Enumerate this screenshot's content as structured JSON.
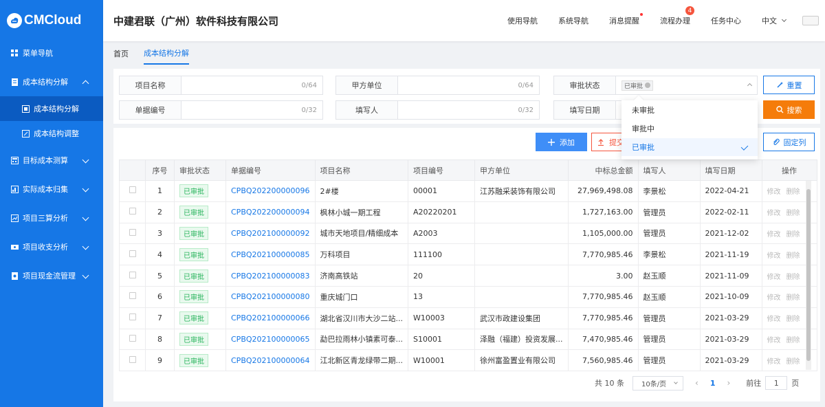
{
  "app": {
    "logo_text": "CMCloud",
    "company": "中建君联（广州）软件科技有限公司"
  },
  "sidebar": {
    "items": [
      {
        "label": "菜单导航",
        "icon": "grid-icon"
      },
      {
        "label": "成本结构分解",
        "icon": "document-icon",
        "expanded": true,
        "children": [
          {
            "label": "成本结构分解",
            "active": true
          },
          {
            "label": "成本结构调整",
            "active": false
          }
        ]
      },
      {
        "label": "目标成本测算",
        "icon": "calc-icon"
      },
      {
        "label": "实际成本归集",
        "icon": "chart-icon"
      },
      {
        "label": "项目三算分析",
        "icon": "analysis-icon"
      },
      {
        "label": "项目收支分析",
        "icon": "money-icon"
      },
      {
        "label": "项目现金流管理",
        "icon": "cashflow-icon"
      }
    ]
  },
  "header": {
    "nav": [
      {
        "label": "使用导航"
      },
      {
        "label": "系统导航"
      },
      {
        "label": "消息提醒",
        "dot": true
      },
      {
        "label": "流程办理",
        "badge": "4"
      },
      {
        "label": "任务中心"
      }
    ],
    "language": "中文"
  },
  "tabs": [
    {
      "label": "首页",
      "active": false
    },
    {
      "label": "成本结构分解",
      "active": true
    }
  ],
  "search": {
    "project_name": {
      "label": "项目名称",
      "counter": "0/64"
    },
    "party_a": {
      "label": "甲方单位",
      "counter": "0/64"
    },
    "approval_status": {
      "label": "审批状态",
      "selected_tag": "已审批"
    },
    "doc_no": {
      "label": "单据编号",
      "counter": "0/32"
    },
    "filler": {
      "label": "填写人",
      "counter": "0/32"
    },
    "fill_date": {
      "label": "填写日期"
    },
    "reset_label": "重置",
    "search_label": "搜索"
  },
  "dropdown": {
    "options": [
      {
        "label": "未审批",
        "selected": false
      },
      {
        "label": "审批中",
        "selected": false
      },
      {
        "label": "已审批",
        "selected": true
      }
    ]
  },
  "toolbar": {
    "add_label": "添加",
    "submit_label": "提交",
    "fix_columns_label": "固定列"
  },
  "table": {
    "columns": [
      "序号",
      "审批状态",
      "单据编号",
      "项目名称",
      "项目编号",
      "甲方单位",
      "中标总金额",
      "填写人",
      "填写日期",
      "操作"
    ],
    "edit_label": "修改",
    "delete_label": "删除",
    "rows": [
      {
        "no": "1",
        "status": "已审批",
        "code": "CPBQ202200000096",
        "name": "2#楼",
        "project_no": "00001",
        "party_a": "江苏融采装饰有限公司",
        "amount": "27,969,498.08",
        "filler": "李景松",
        "date": "2022-04-21"
      },
      {
        "no": "2",
        "status": "已审批",
        "code": "CPBQ202200000094",
        "name": "枫林小城一期工程",
        "project_no": "A20220201",
        "party_a": "",
        "amount": "1,727,163.00",
        "filler": "管理员",
        "date": "2022-02-11"
      },
      {
        "no": "3",
        "status": "已审批",
        "code": "CPBQ202100000092",
        "name": "城市天地项目/精细成本",
        "project_no": "A2003",
        "party_a": "",
        "amount": "1,105,000.00",
        "filler": "管理员",
        "date": "2021-12-02"
      },
      {
        "no": "4",
        "status": "已审批",
        "code": "CPBQ202100000085",
        "name": "万科项目",
        "project_no": "111100",
        "party_a": "",
        "amount": "7,770,985.46",
        "filler": "李景松",
        "date": "2021-11-19"
      },
      {
        "no": "5",
        "status": "已审批",
        "code": "CPBQ202100000083",
        "name": "济南高铁站",
        "project_no": "20",
        "party_a": "",
        "amount": "3.00",
        "filler": "赵玉顺",
        "date": "2021-11-09"
      },
      {
        "no": "6",
        "status": "已审批",
        "code": "CPBQ202100000080",
        "name": "重庆城门口",
        "project_no": "13",
        "party_a": "",
        "amount": "7,770,985.46",
        "filler": "赵玉顺",
        "date": "2021-10-09"
      },
      {
        "no": "7",
        "status": "已审批",
        "code": "CPBQ202100000066",
        "name": "湖北省汉川市大沙二站...",
        "project_no": "W10003",
        "party_a": "武汉市政建设集团",
        "amount": "7,770,985.46",
        "filler": "管理员",
        "date": "2021-03-29"
      },
      {
        "no": "8",
        "status": "已审批",
        "code": "CPBQ202100000065",
        "name": "勐巴拉雨林小镇素可泰...",
        "project_no": "S10001",
        "party_a": "泽融（福建）投资发展...",
        "amount": "7,470,985.46",
        "filler": "管理员",
        "date": "2021-03-29"
      },
      {
        "no": "9",
        "status": "已审批",
        "code": "CPBQ202100000064",
        "name": "江北新区青龙绿带二期...",
        "project_no": "W10001",
        "party_a": "徐州富盈置业有限公司",
        "amount": "7,560,985.46",
        "filler": "管理员",
        "date": "2021-03-29"
      }
    ]
  },
  "pagination": {
    "total_text": "共 10 条",
    "page_size": "10条/页",
    "current_page": "1",
    "goto_label": "前往",
    "goto_value": "1",
    "page_unit": "页"
  },
  "colors": {
    "primary": "#1677e6",
    "sidebar_bg": "#1677e6",
    "sidebar_active": "#0b5bc1",
    "search_btn": "#f57c0a",
    "status_green": "#25b35a"
  }
}
